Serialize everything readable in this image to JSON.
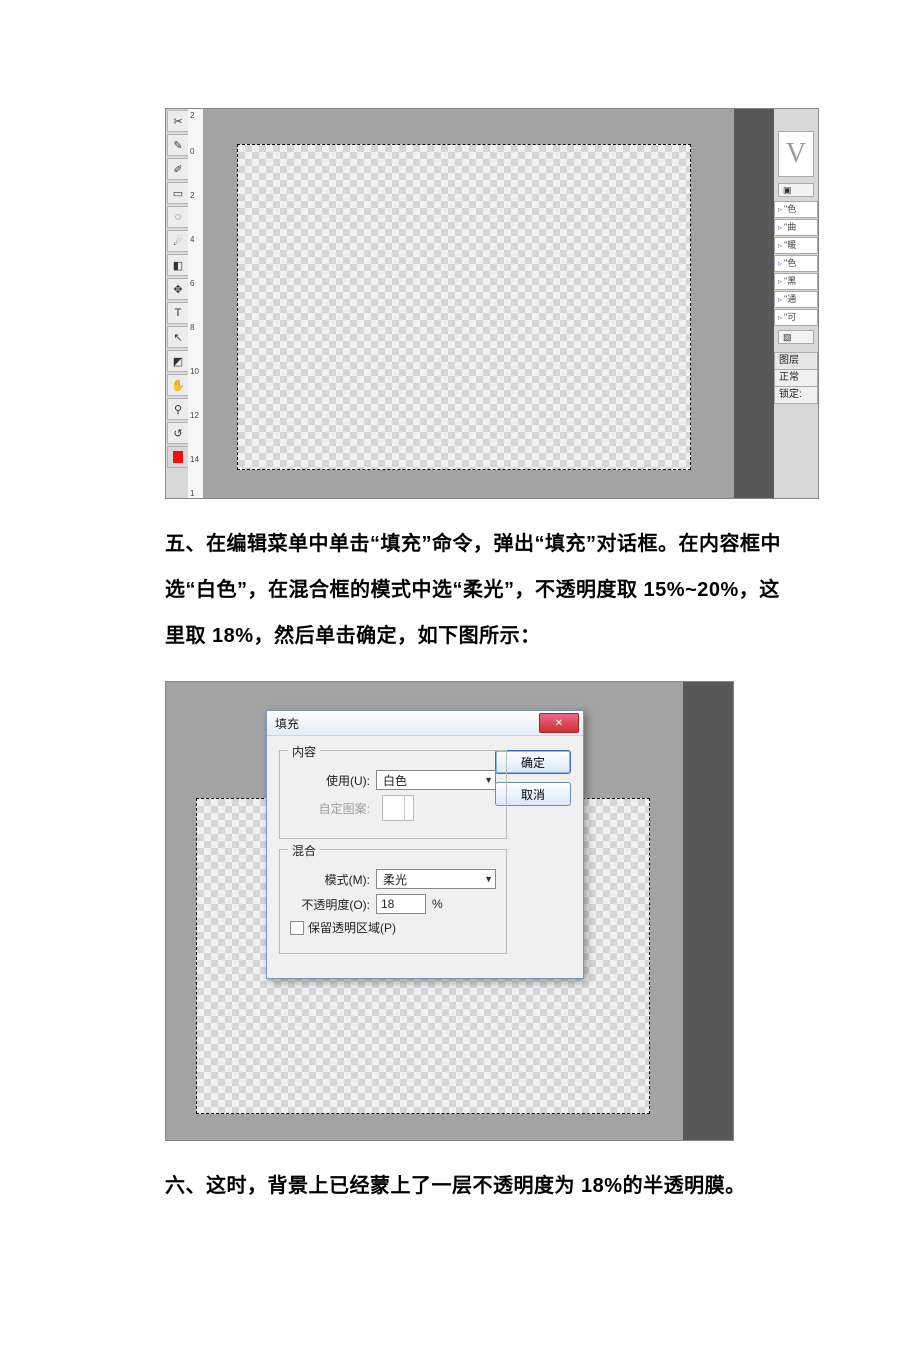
{
  "screenshot1": {
    "ruler_marks": [
      "2",
      "0",
      "2",
      "4",
      "6",
      "8",
      "10",
      "12",
      "14",
      "1"
    ],
    "panel_logo": "V",
    "history_items": [
      "\"色",
      "\"曲",
      "\"暖",
      "\"色",
      "\"黑",
      "\"通",
      "\"可"
    ],
    "layers_tab": "图层",
    "blend_mode_label": "正常",
    "lock_label": "锁定:"
  },
  "paragraph1": "五、在编辑菜单中单击“填充”命令，弹出“填充”对话框。在内容框中选“白色”，在混合框的模式中选“柔光”，不透明度取 15%~20%，这里取 18%，然后单击确定，如下图所示：",
  "dialog": {
    "title": "填充",
    "close": "✕",
    "ok": "确定",
    "cancel": "取消",
    "content_group": "内容",
    "use_label": "使用(U):",
    "use_value": "白色",
    "pattern_label": "自定图案:",
    "blend_group": "混合",
    "mode_label": "模式(M):",
    "mode_value": "柔光",
    "opacity_label": "不透明度(O):",
    "opacity_value": "18",
    "opacity_unit": "%",
    "preserve_label": "保留透明区域(P)"
  },
  "paragraph2": "六、这时，背景上已经蒙上了一层不透明度为 18%的半透明膜。"
}
